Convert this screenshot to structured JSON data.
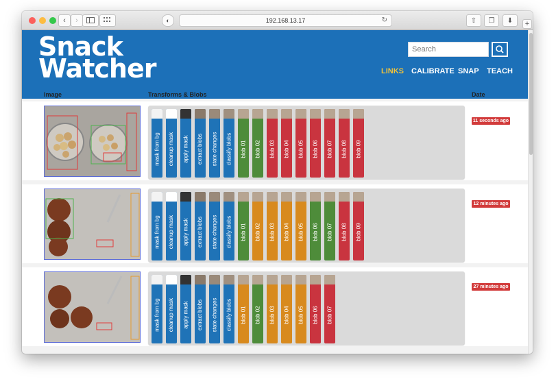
{
  "browser": {
    "url": "192.168.13.17"
  },
  "header": {
    "logo_line1": "Snack",
    "logo_line2": "Watcher",
    "search_placeholder": "Search",
    "nav": [
      "LINKS",
      "CALIBRATE",
      "SNAP",
      "TEACH"
    ],
    "active_nav": "LINKS"
  },
  "table": {
    "col_image": "Image",
    "col_transforms": "Transforms & Blobs",
    "col_date": "Date"
  },
  "colors": {
    "blue": "#1f73b7",
    "green": "#4e8c3a",
    "red": "#c9343f",
    "orange": "#d88a1e",
    "badge": "#d23b3b"
  },
  "transforms": [
    "mask from bg",
    "cleanup mask",
    "apply mask",
    "extract blobs",
    "state changes",
    "classify blobs"
  ],
  "rows": [
    {
      "date": "11 seconds ago",
      "blobs": [
        {
          "label": "blob 01",
          "state": "green"
        },
        {
          "label": "blob 02",
          "state": "green"
        },
        {
          "label": "blob 03",
          "state": "red"
        },
        {
          "label": "blob 04",
          "state": "red"
        },
        {
          "label": "blob 05",
          "state": "red"
        },
        {
          "label": "blob 06",
          "state": "red"
        },
        {
          "label": "blob 07",
          "state": "red"
        },
        {
          "label": "blob 08",
          "state": "red"
        },
        {
          "label": "blob 09",
          "state": "red"
        }
      ]
    },
    {
      "date": "12 minutes ago",
      "blobs": [
        {
          "label": "blob 01",
          "state": "green"
        },
        {
          "label": "blob 02",
          "state": "orange"
        },
        {
          "label": "blob 03",
          "state": "orange"
        },
        {
          "label": "blob 04",
          "state": "orange"
        },
        {
          "label": "blob 05",
          "state": "orange"
        },
        {
          "label": "blob 06",
          "state": "green"
        },
        {
          "label": "blob 07",
          "state": "green"
        },
        {
          "label": "blob 08",
          "state": "red"
        },
        {
          "label": "blob 09",
          "state": "red"
        }
      ]
    },
    {
      "date": "27 minutes ago",
      "blobs": [
        {
          "label": "blob 01",
          "state": "orange"
        },
        {
          "label": "blob 02",
          "state": "green"
        },
        {
          "label": "blob 03",
          "state": "orange"
        },
        {
          "label": "blob 04",
          "state": "orange"
        },
        {
          "label": "blob 05",
          "state": "orange"
        },
        {
          "label": "blob 06",
          "state": "red"
        },
        {
          "label": "blob 07",
          "state": "red"
        }
      ]
    }
  ]
}
